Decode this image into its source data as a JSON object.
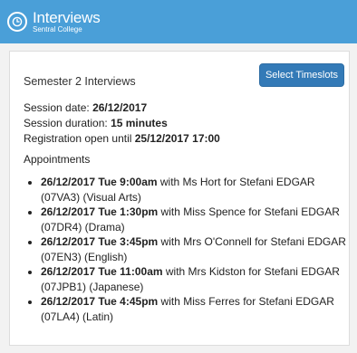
{
  "header": {
    "logo_icon": "clock-icon",
    "title": "Interviews",
    "subtitle": "Sentral College",
    "bg_color": "#4a9fd8"
  },
  "panel": {
    "title": "Semester 2 Interviews",
    "select_button_label": "Select Timeslots",
    "button_color": "#337ab7"
  },
  "session": {
    "date_label": "Session date: ",
    "date_value": "26/12/2017",
    "duration_label": "Session duration: ",
    "duration_value": "15 minutes",
    "registration_label": "Registration open until ",
    "registration_value": "25/12/2017 17:00"
  },
  "appointments": {
    "heading": "Appointments",
    "items": [
      {
        "when": "26/12/2017 Tue 9:00am",
        "rest": " with Ms Hort for Stefani EDGAR (07VA3) (Visual Arts)"
      },
      {
        "when": "26/12/2017 Tue 1:30pm",
        "rest": " with Miss Spence for Stefani EDGAR (07DR4) (Drama)"
      },
      {
        "when": "26/12/2017 Tue 3:45pm",
        "rest": " with Mrs O'Connell for Stefani EDGAR (07EN3) (English)"
      },
      {
        "when": "26/12/2017 Tue 11:00am",
        "rest": " with Mrs Kidston for Stefani EDGAR (07JPB1) (Japanese)"
      },
      {
        "when": "26/12/2017 Tue 4:45pm",
        "rest": " with Miss Ferres for Stefani EDGAR (07LA4) (Latin)"
      }
    ]
  }
}
